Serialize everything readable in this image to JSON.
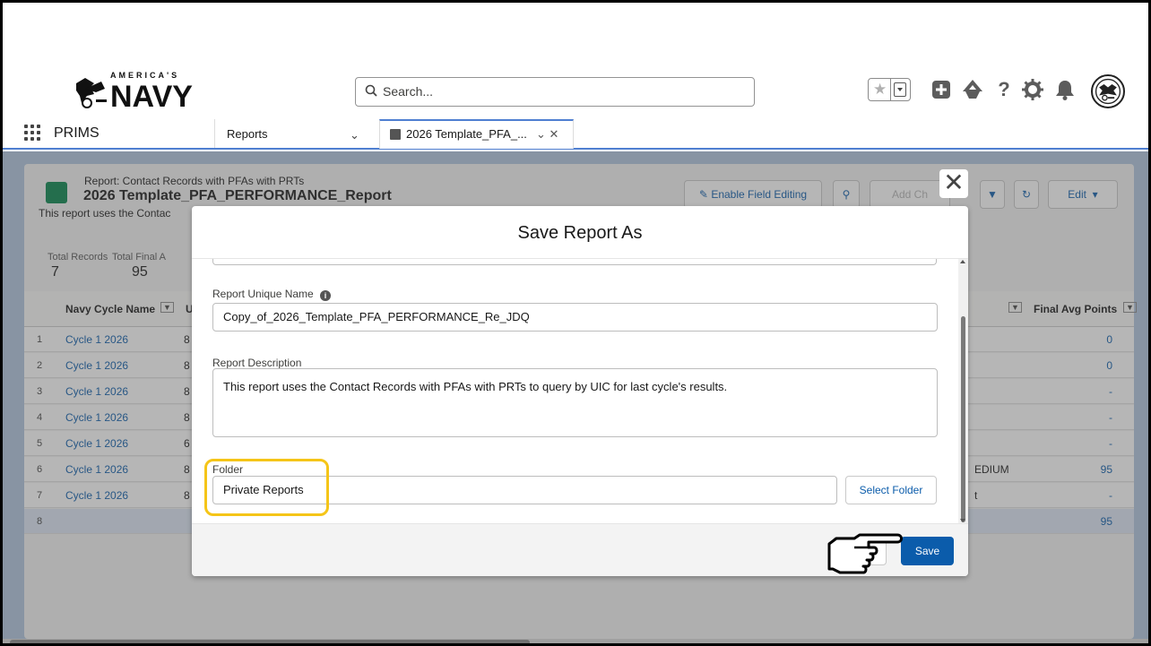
{
  "header": {
    "logo_text": "AMERICA'S NAVY",
    "search_placeholder": "Search..."
  },
  "icons": {
    "favorites": "star-icon",
    "add": "plus-icon",
    "trailhead": "trailhead-icon",
    "help": "help-icon",
    "setup": "gear-icon",
    "notifications": "bell-icon",
    "avatar": "navy-emblem-avatar"
  },
  "nav": {
    "app_name": "PRIMS",
    "reports_tab": "Reports",
    "active_tab": "2026 Template_PFA_..."
  },
  "report": {
    "subtitle": "Report: Contact Records with PFAs with PRTs",
    "title": "2026 Template_PFA_PERFORMANCE_Report",
    "description": "This report uses the Contac",
    "enable_field_editing": "Enable Field Editing",
    "add_chart": "Add Ch",
    "edit": "Edit",
    "total_records_label": "Total Records",
    "total_records_value": "7",
    "total_final_label": "Total Final A",
    "total_final_value": "95",
    "col_navy_cycle": "Navy Cycle Name",
    "col_u": "U",
    "col_final_avg": "Final Avg Points",
    "rows": [
      {
        "n": "1",
        "cycle": "Cycle 1 2026",
        "u": "8",
        "c3": "",
        "final": "0"
      },
      {
        "n": "2",
        "cycle": "Cycle 1 2026",
        "u": "8",
        "c3": "",
        "final": "0"
      },
      {
        "n": "3",
        "cycle": "Cycle 1 2026",
        "u": "8",
        "c3": "",
        "final": "-"
      },
      {
        "n": "4",
        "cycle": "Cycle 1 2026",
        "u": "8",
        "c3": "",
        "final": "-"
      },
      {
        "n": "5",
        "cycle": "Cycle 1 2026",
        "u": "6",
        "c3": "",
        "final": "-"
      },
      {
        "n": "6",
        "cycle": "Cycle 1 2026",
        "u": "8",
        "c3": "EDIUM",
        "final": "95"
      },
      {
        "n": "7",
        "cycle": "Cycle 1 2026",
        "u": "8",
        "c3": "t",
        "final": "-"
      },
      {
        "n": "8",
        "cycle": "",
        "u": "",
        "c3": "",
        "final": "95"
      }
    ]
  },
  "modal": {
    "title": "Save Report As",
    "unique_name_label": "Report Unique Name",
    "unique_name_value": "Copy_of_2026_Template_PFA_PERFORMANCE_Re_JDQ",
    "description_label": "Report Description",
    "description_value": "This report uses the Contact Records with PFAs with PRTs to query by UIC for last cycle's results.",
    "folder_label": "Folder",
    "folder_value": "Private Reports",
    "select_folder": "Select Folder",
    "save": "Save"
  }
}
